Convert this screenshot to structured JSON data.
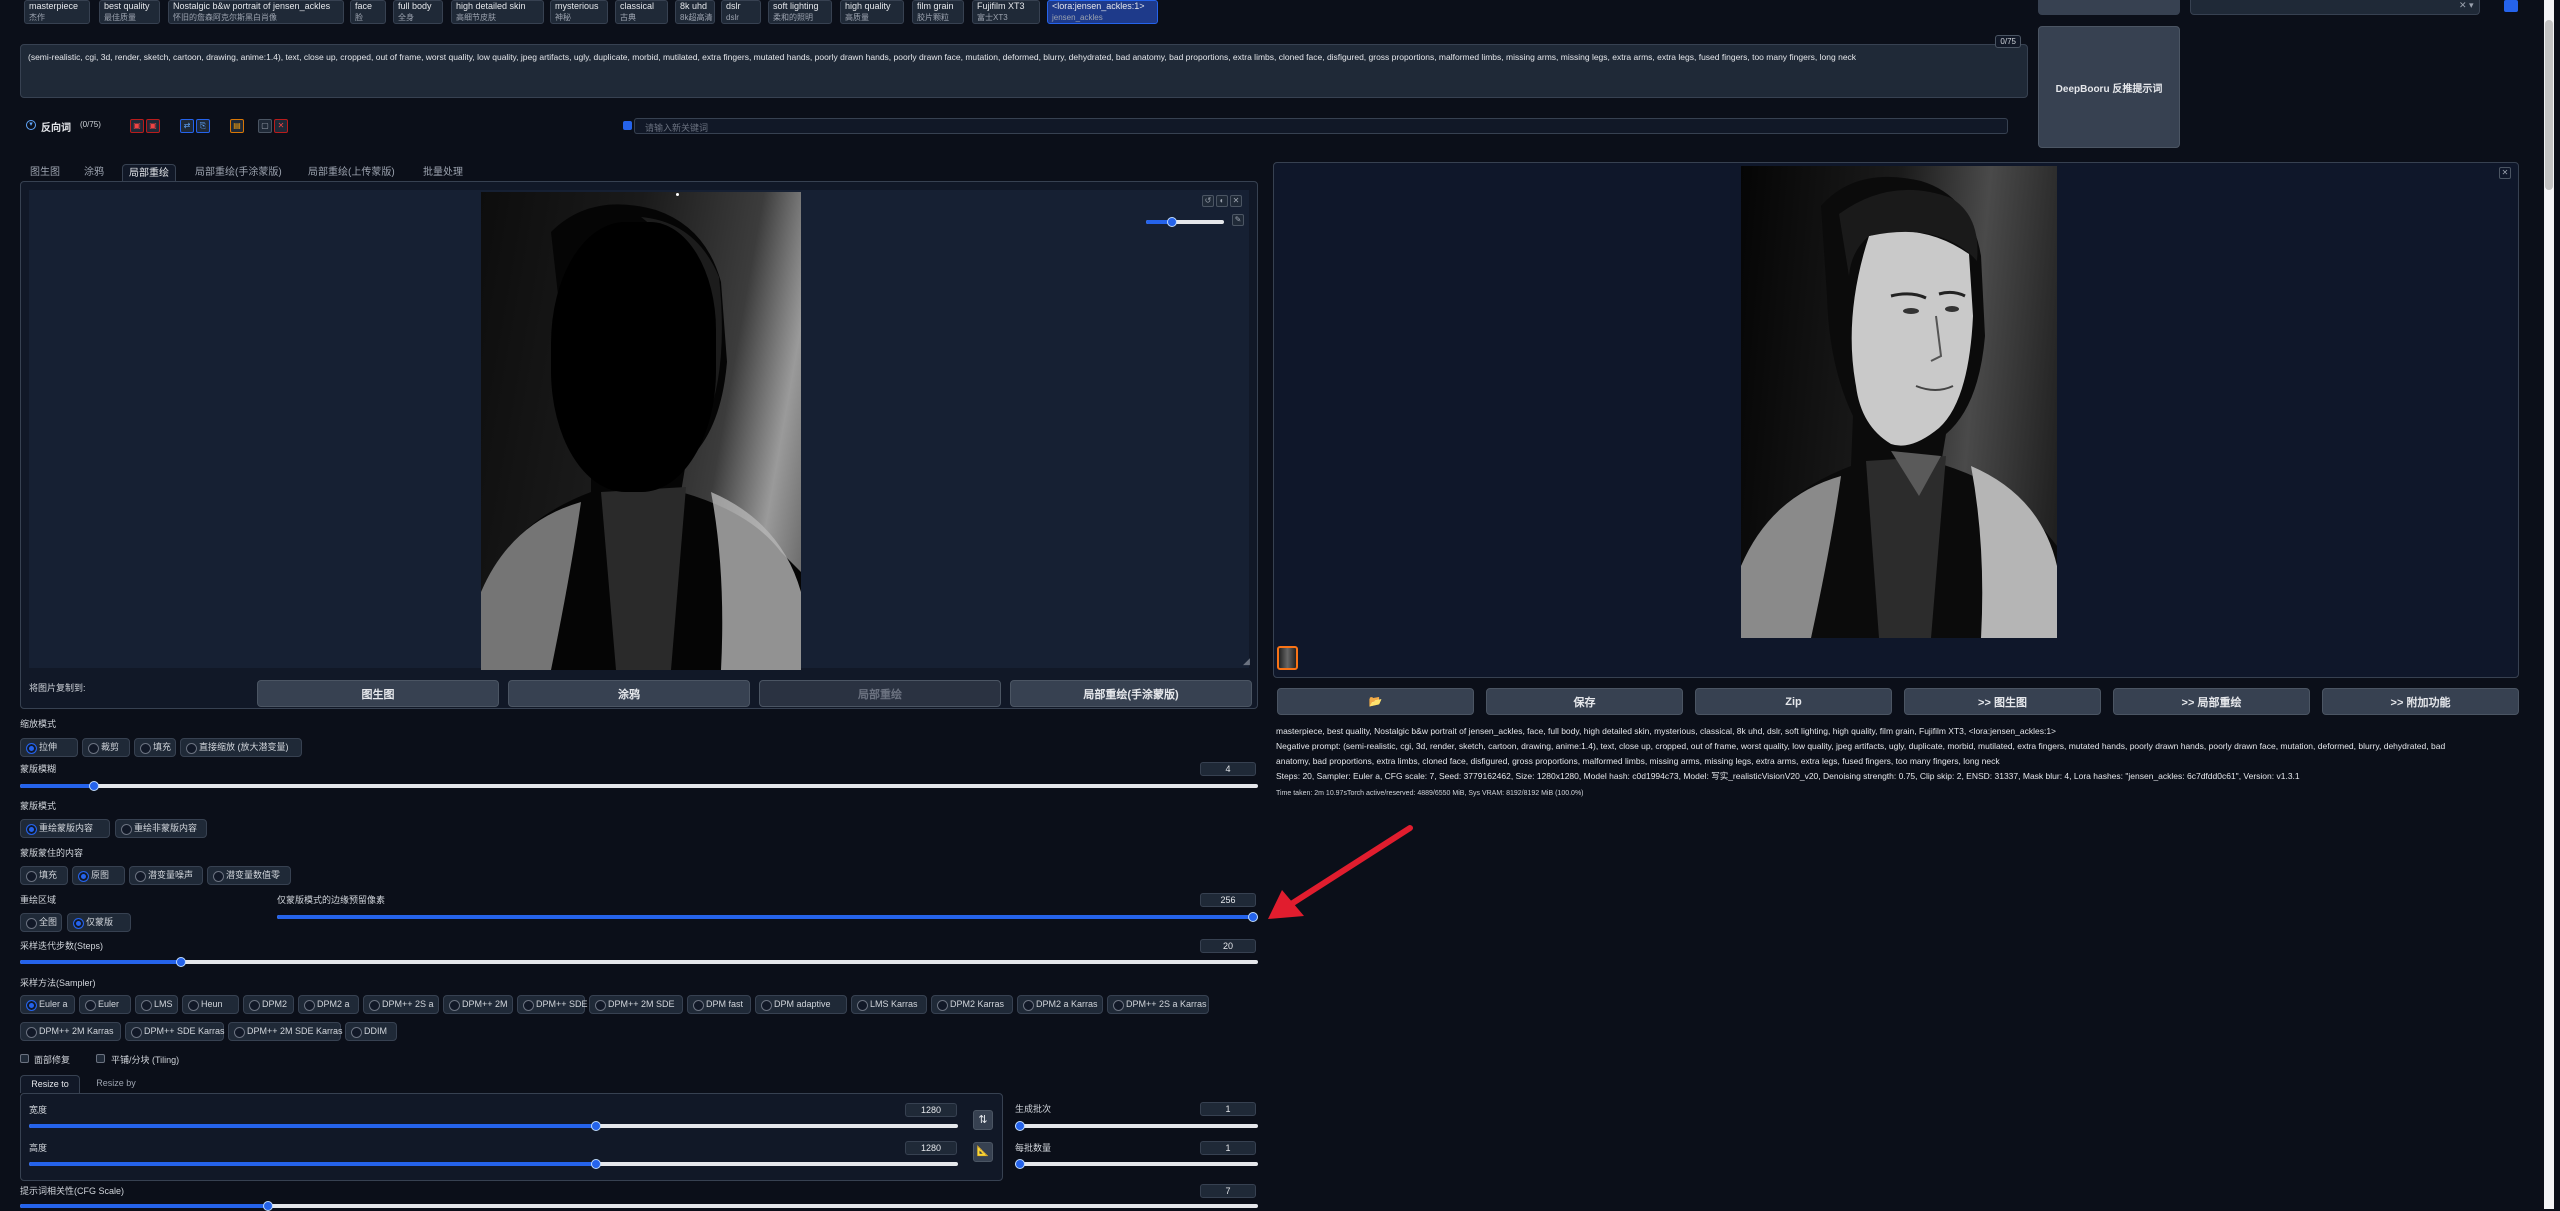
{
  "tags": [
    {
      "label": "masterpiece",
      "sub": "杰作"
    },
    {
      "label": "best quality",
      "sub": "最佳质量"
    },
    {
      "label": "Nostalgic b&w portrait of jensen_ackles",
      "sub": "怀旧的詹森阿克尔斯黑白肖像"
    },
    {
      "label": "face",
      "sub": "脸"
    },
    {
      "label": "full body",
      "sub": "全身"
    },
    {
      "label": "high detailed skin",
      "sub": "高细节皮肤"
    },
    {
      "label": "mysterious",
      "sub": "神秘"
    },
    {
      "label": "classical",
      "sub": "古典"
    },
    {
      "label": "8k uhd",
      "sub": "8k超高清"
    },
    {
      "label": "dslr",
      "sub": "dslr"
    },
    {
      "label": "soft lighting",
      "sub": "柔和的照明"
    },
    {
      "label": "high quality",
      "sub": "高质量"
    },
    {
      "label": "film grain",
      "sub": "胶片颗粒"
    },
    {
      "label": "Fujifilm XT3",
      "sub": "富士XT3"
    },
    {
      "label": "<lora:jensen_ackles:1>",
      "sub": "jensen_ackles"
    }
  ],
  "negative_prompt": {
    "text": "(semi-realistic, cgi, 3d, render, sketch, cartoon, drawing, anime:1.4), text, close up, cropped, out of frame, worst quality, low quality, jpeg artifacts, ugly, duplicate, morbid, mutilated, extra fingers, mutated hands, poorly drawn hands, poorly drawn face, mutation, deformed, blurry, dehydrated, bad anatomy, bad proportions, extra limbs, cloned face, disfigured, gross proportions, malformed limbs, missing arms, missing legs, extra arms, extra legs, fused fingers, too many fingers, long neck",
    "counter": "0/75"
  },
  "deepbooru_label": "DeepBooru 反推提示词",
  "neg_bar": {
    "label": "反向词",
    "counter": "(0/75)",
    "input_placeholder": "请输入新关键词"
  },
  "tabs": [
    "图生图",
    "涂鸦",
    "局部重绘",
    "局部重绘(手涂蒙版)",
    "局部重绘(上传蒙版)",
    "批量处理"
  ],
  "copy_to": {
    "label": "将图片复制到:",
    "buttons": [
      "图生图",
      "涂鸦",
      "局部重绘",
      "局部重绘(手涂蒙版)"
    ]
  },
  "output_buttons": [
    "📂",
    "保存",
    "Zip",
    ">> 图生图",
    ">> 局部重绘",
    ">> 附加功能"
  ],
  "info": {
    "positive": "masterpiece, best quality, Nostalgic b&w portrait of jensen_ackles, face, full body, high detailed skin, mysterious, classical, 8k uhd, dslr, soft lighting, high quality, film grain, Fujifilm XT3, <lora:jensen_ackles:1>",
    "negative_line1": "Negative prompt: (semi-realistic, cgi, 3d, render, sketch, cartoon, drawing, anime:1.4), text, close up, cropped, out of frame, worst quality, low quality, jpeg artifacts, ugly, duplicate, morbid, mutilated, extra fingers, mutated hands, poorly drawn hands, poorly drawn face, mutation, deformed, blurry, dehydrated, bad",
    "negative_line2": "anatomy, bad proportions, extra limbs, cloned face, disfigured, gross proportions, malformed limbs, missing arms, missing legs, extra arms, extra legs, fused fingers, too many fingers, long neck",
    "params": "Steps: 20, Sampler: Euler a, CFG scale: 7, Seed: 3779162462, Size: 1280x1280, Model hash: c0d1994c73, Model: 写实_realisticVisionV20_v20, Denoising strength: 0.75, Clip skip: 2, ENSD: 31337, Mask blur: 4, Lora hashes: \"jensen_ackles: 6c7dfdd0c61\", Version: v1.3.1",
    "time": "Time taken: 2m 10.97sTorch active/reserved: 4889/6550 MiB, Sys VRAM: 8192/8192 MiB (100.0%)"
  },
  "resize_mode": {
    "label": "缩放模式",
    "options": [
      "拉伸",
      "裁剪",
      "填充",
      "直接缩放 (放大潜变量)"
    ],
    "selected": 0
  },
  "mask_blur": {
    "label": "蒙版模糊",
    "value": "4",
    "fraction": 0.06
  },
  "mask_mode": {
    "label": "蒙版模式",
    "options": [
      "重绘蒙版内容",
      "重绘非蒙版内容"
    ],
    "selected": 0
  },
  "masked_content": {
    "label": "蒙版蒙住的内容",
    "options": [
      "填充",
      "原图",
      "潜变量噪声",
      "潜变量数值零"
    ],
    "selected": 1
  },
  "inpaint_area": {
    "label": "重绘区域",
    "options": [
      "全图",
      "仅蒙版"
    ],
    "selected": 1
  },
  "only_masked_padding": {
    "label": "仅蒙版模式的边缘预留像素",
    "value": "256",
    "fraction": 1.0
  },
  "steps": {
    "label": "采样迭代步数(Steps)",
    "value": "20",
    "fraction": 0.13
  },
  "sampler": {
    "label": "采样方法(Sampler)",
    "options": [
      "Euler a",
      "Euler",
      "LMS",
      "Heun",
      "DPM2",
      "DPM2 a",
      "DPM++ 2S a",
      "DPM++ 2M",
      "DPM++ SDE",
      "DPM++ 2M SDE",
      "DPM fast",
      "DPM adaptive",
      "LMS Karras",
      "DPM2 Karras",
      "DPM2 a Karras",
      "DPM++ 2S a Karras",
      "DPM++ 2M Karras",
      "DPM++ SDE Karras",
      "DPM++ 2M SDE Karras",
      "DDIM"
    ],
    "selected": 0
  },
  "checkboxes": [
    "面部修复",
    "平铺/分块 (Tiling)"
  ],
  "resize_tabs": [
    "Resize to",
    "Resize by"
  ],
  "width": {
    "label": "宽度",
    "value": "1280",
    "fraction": 0.61
  },
  "height": {
    "label": "高度",
    "value": "1280",
    "fraction": 0.61
  },
  "batch_count": {
    "label": "生成批次",
    "value": "1",
    "fraction": 0.0
  },
  "batch_size": {
    "label": "每批数量",
    "value": "1",
    "fraction": 0.0
  },
  "cfg": {
    "label": "提示词相关性(CFG Scale)",
    "value": "7",
    "fraction": 0.2
  },
  "colors": {
    "accent": "#2563eb",
    "bg": "#0b0f19",
    "panel": "#111827",
    "annotation": "#e11d2e"
  }
}
